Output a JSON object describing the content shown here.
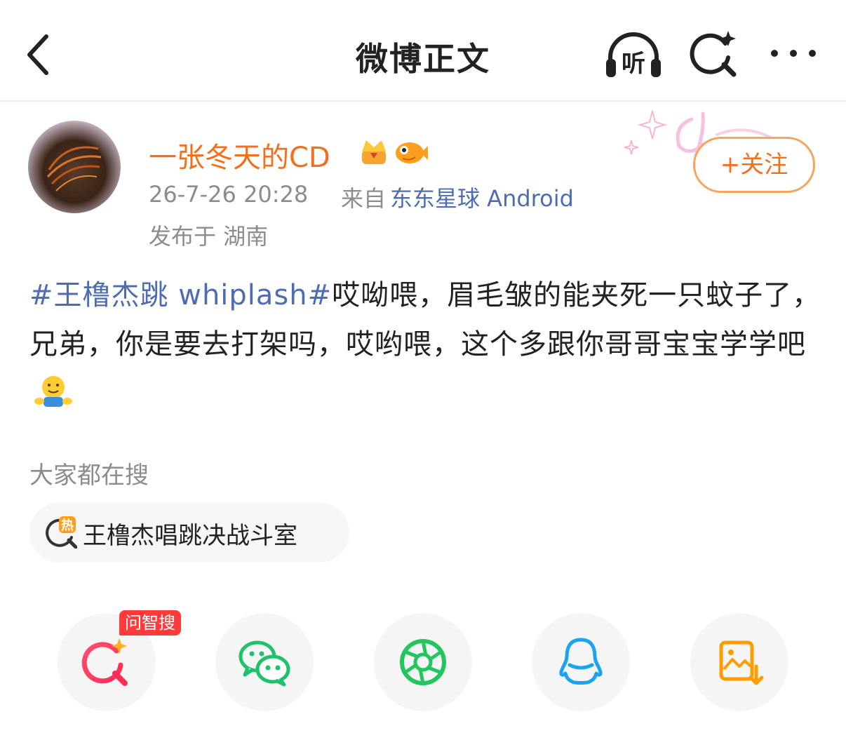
{
  "header": {
    "title": "微博正文",
    "listen_label": "听"
  },
  "author": {
    "name": "一张冬天的CD",
    "time": "26-7-26 20:28",
    "source_prefix": "来自",
    "source_name": "东东星球 Android",
    "location": "发布于 湖南",
    "follow_label": "+关注"
  },
  "post": {
    "topic": "#王橹杰跳 whiplash#",
    "text": "哎呦喂，眉毛皱的能夹死一只蚊子了，兄弟，你是要去打架吗，哎哟喂，这个多跟你哥哥宝宝学学吧"
  },
  "search": {
    "label": "大家都在搜",
    "hot_icon_text": "热",
    "hot_item": "王橹杰唱跳决战斗室"
  },
  "share": {
    "badge": "问智搜"
  },
  "colors": {
    "accent_orange": "#f2701c",
    "link_blue": "#4d6db0",
    "badge_red": "#ff3a3a",
    "wechat_green": "#1fc16b",
    "qq_blue": "#1aa3f0",
    "save_orange": "#ff9d00"
  },
  "icons": {
    "back": "chevron-left-icon",
    "listen": "headphones-icon",
    "search": "sparkle-search-icon",
    "more": "more-dots-icon",
    "crown": "crown-icon",
    "fish": "fish-icon",
    "emoji": "hug-emoji-icon",
    "share_ai": "ai-search-icon",
    "share_wechat": "wechat-icon",
    "share_moments": "moments-icon",
    "share_qq": "qq-icon",
    "share_save": "save-image-icon"
  }
}
